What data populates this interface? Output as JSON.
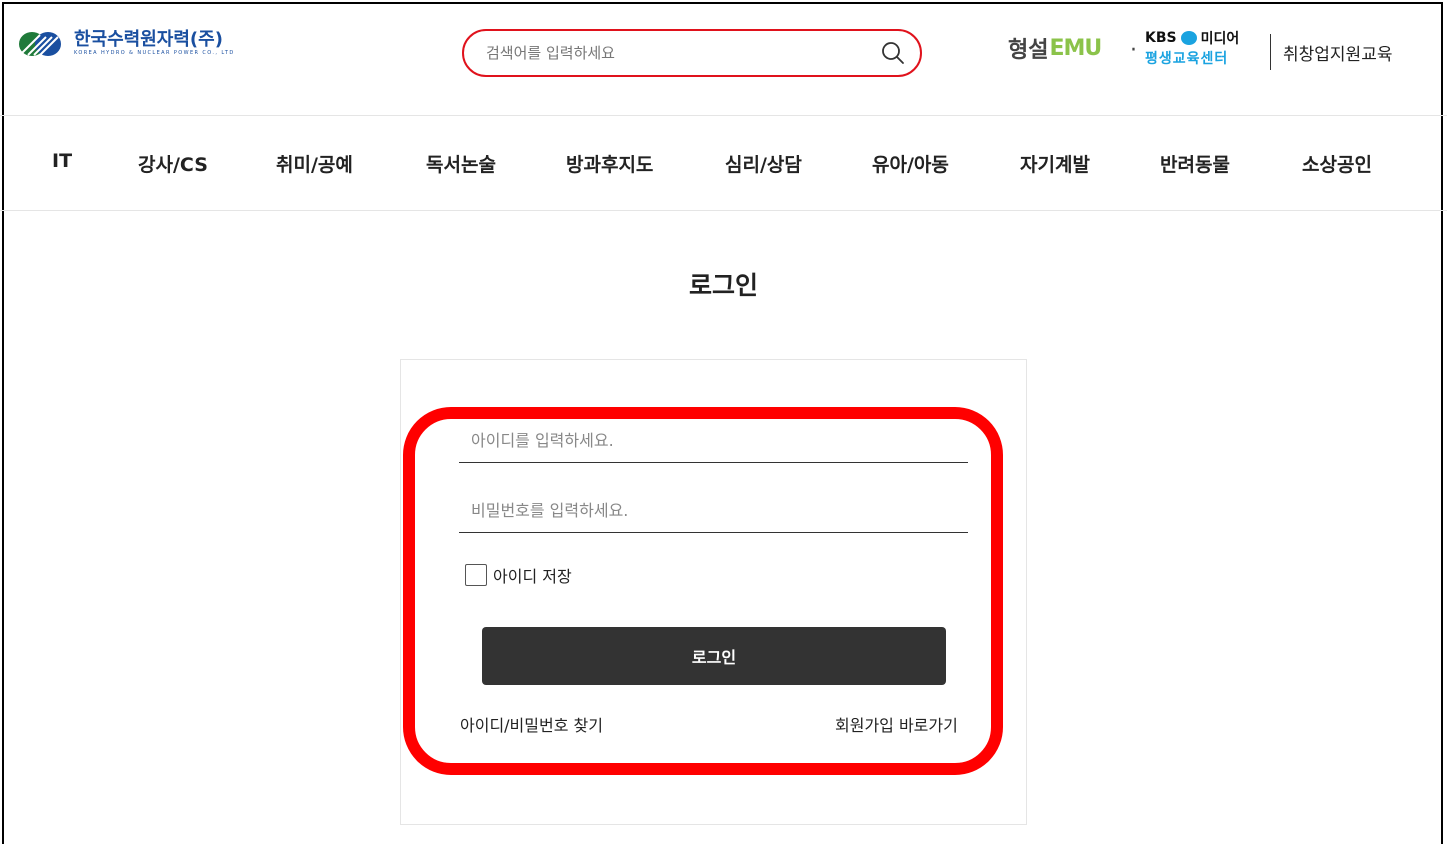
{
  "header": {
    "logo": {
      "text_kr": "한국수력원자력(주)",
      "text_en": "KOREA HYDRO & NUCLEAR POWER CO., LTD"
    },
    "search": {
      "placeholder": "검색어를 입력하세요",
      "value": ""
    },
    "brands": {
      "hyeongseol": "형설",
      "emu": "EMU",
      "separator": "·",
      "kbs_top_prefix": "KBS",
      "kbs_top_suffix": "미디어",
      "kbs_bottom": "평생교육센터",
      "job_training": "취창업지원교육"
    }
  },
  "nav": {
    "items": [
      {
        "label": "IT"
      },
      {
        "label": "강사/CS"
      },
      {
        "label": "취미/공예"
      },
      {
        "label": "독서논술"
      },
      {
        "label": "방과후지도"
      },
      {
        "label": "심리/상담"
      },
      {
        "label": "유아/아동"
      },
      {
        "label": "자기계발"
      },
      {
        "label": "반려동물"
      },
      {
        "label": "소상공인"
      }
    ]
  },
  "login": {
    "title": "로그인",
    "id_placeholder": "아이디를 입력하세요.",
    "id_value": "",
    "pw_placeholder": "비밀번호를 입력하세요.",
    "pw_value": "",
    "remember_label": "아이디 저장",
    "remember_checked": false,
    "button_label": "로그인",
    "find_link": "아이디/비밀번호 찾기",
    "join_link": "회원가입 바로가기"
  },
  "colors": {
    "search_border": "#e0121c",
    "highlight": "#ff0000",
    "button_bg": "#333333",
    "logo_blue": "#1a4fa0",
    "emu_green": "#8bc34a",
    "kbs_blue": "#1aa3e0"
  }
}
